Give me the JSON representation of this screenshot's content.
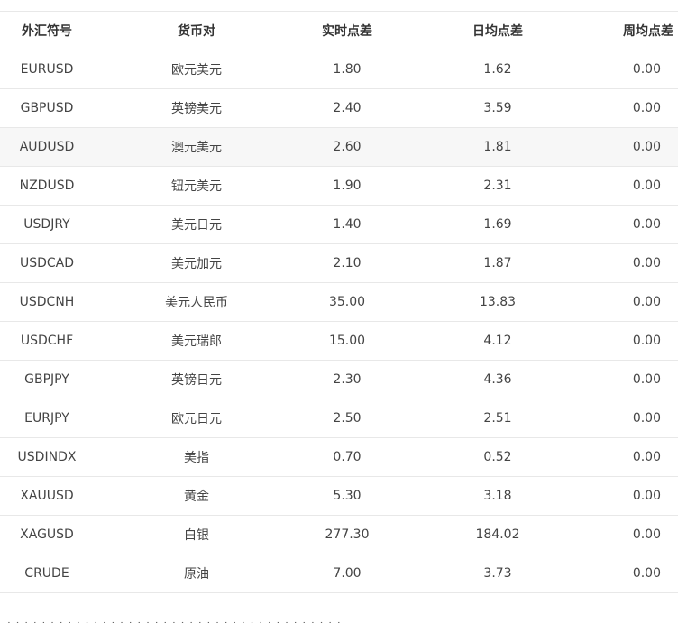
{
  "table": {
    "headers": {
      "symbol": "外汇符号",
      "pair": "货币对",
      "realtime": "实时点差",
      "daily": "日均点差",
      "weekly": "周均点差"
    },
    "rows": [
      {
        "symbol": "EURUSD",
        "pair": "欧元美元",
        "realtime": "1.80",
        "daily": "1.62",
        "weekly": "0.00"
      },
      {
        "symbol": "GBPUSD",
        "pair": "英镑美元",
        "realtime": "2.40",
        "daily": "3.59",
        "weekly": "0.00"
      },
      {
        "symbol": "AUDUSD",
        "pair": "澳元美元",
        "realtime": "2.60",
        "daily": "1.81",
        "weekly": "0.00"
      },
      {
        "symbol": "NZDUSD",
        "pair": "钮元美元",
        "realtime": "1.90",
        "daily": "2.31",
        "weekly": "0.00"
      },
      {
        "symbol": "USDJRY",
        "pair": "美元日元",
        "realtime": "1.40",
        "daily": "1.69",
        "weekly": "0.00"
      },
      {
        "symbol": "USDCAD",
        "pair": "美元加元",
        "realtime": "2.10",
        "daily": "1.87",
        "weekly": "0.00"
      },
      {
        "symbol": "USDCNH",
        "pair": "美元人民币",
        "realtime": "35.00",
        "daily": "13.83",
        "weekly": "0.00"
      },
      {
        "symbol": "USDCHF",
        "pair": "美元瑞郎",
        "realtime": "15.00",
        "daily": "4.12",
        "weekly": "0.00"
      },
      {
        "symbol": "GBPJPY",
        "pair": "英镑日元",
        "realtime": "2.30",
        "daily": "4.36",
        "weekly": "0.00"
      },
      {
        "symbol": "EURJPY",
        "pair": "欧元日元",
        "realtime": "2.50",
        "daily": "2.51",
        "weekly": "0.00"
      },
      {
        "symbol": "USDINDX",
        "pair": "美指",
        "realtime": "0.70",
        "daily": "0.52",
        "weekly": "0.00"
      },
      {
        "symbol": "XAUUSD",
        "pair": "黄金",
        "realtime": "5.30",
        "daily": "3.18",
        "weekly": "0.00"
      },
      {
        "symbol": "XAGUSD",
        "pair": "白银",
        "realtime": "277.30",
        "daily": "184.02",
        "weekly": "0.00"
      },
      {
        "symbol": "CRUDE",
        "pair": "原油",
        "realtime": "7.00",
        "daily": "3.73",
        "weekly": "0.00"
      }
    ]
  },
  "colors": {
    "row_highlight": "#f7f7f7",
    "border": "#e8e8e8",
    "text": "#444444"
  }
}
